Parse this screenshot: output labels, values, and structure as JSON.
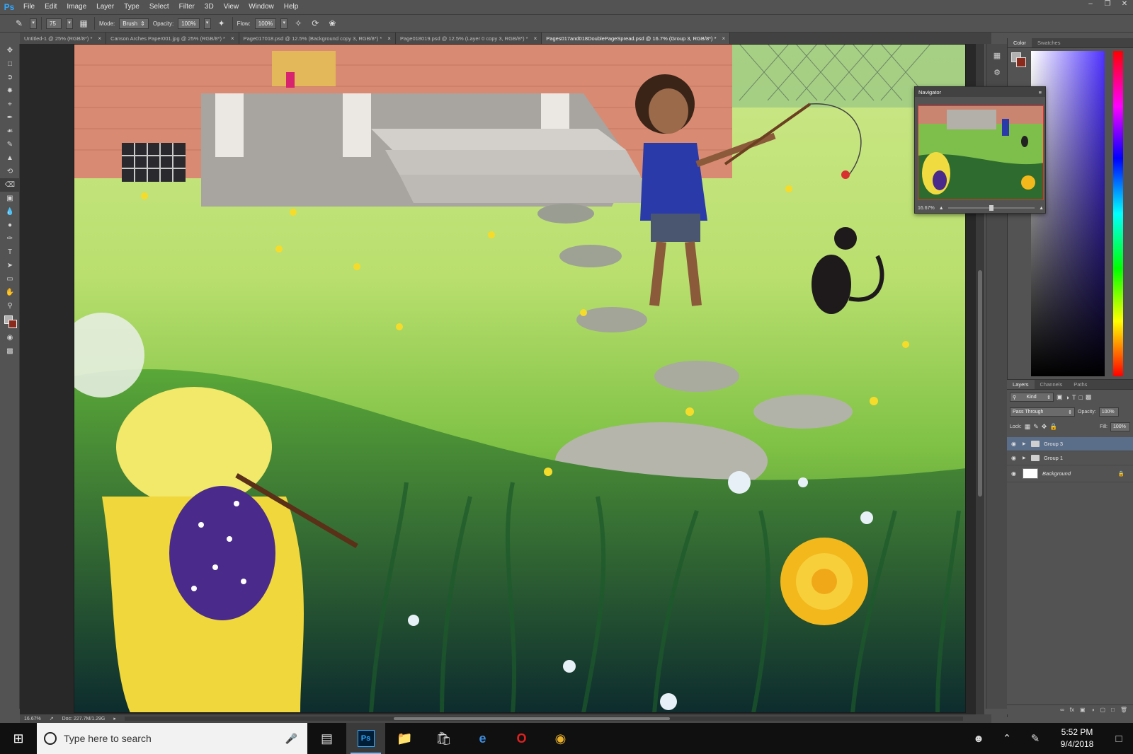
{
  "app": {
    "logo": "Ps",
    "menu": [
      "File",
      "Edit",
      "Image",
      "Layer",
      "Type",
      "Select",
      "Filter",
      "3D",
      "View",
      "Window",
      "Help"
    ],
    "window_controls": [
      "–",
      "❐",
      "✕"
    ]
  },
  "options_bar": {
    "brush_size": "75",
    "mode_label": "Mode:",
    "mode_value": "Brush",
    "opacity_label": "Opacity:",
    "opacity_value": "100%",
    "flow_label": "Flow:",
    "flow_value": "100%"
  },
  "tabs": [
    {
      "label": "Untitled-1 @ 25% (RGB/8*) *",
      "active": false
    },
    {
      "label": "Canson Arches Paper001.jpg @ 25% (RGB/8*) *",
      "active": false
    },
    {
      "label": "Page017018.psd @ 12.5% (Background copy 3, RGB/8*) *",
      "active": false
    },
    {
      "label": "Page018019.psd @ 12.5% (Layer 0 copy 3, RGB/8*) *",
      "active": false
    },
    {
      "label": "Pages017and018DoublePageSpread.psd @ 16.7% (Group 3, RGB/8*) *",
      "active": true
    }
  ],
  "status_bar": {
    "zoom": "16.67%",
    "doc": "Doc: 227.7M/1.29G"
  },
  "color_panel": {
    "tabs": [
      "Color",
      "Swatches"
    ],
    "fg_color": "#b1b1b1",
    "bg_color": "#8a2a1c"
  },
  "navigator": {
    "title": "Navigator",
    "zoom": "16.67%"
  },
  "layers_panel": {
    "tabs": [
      "Layers",
      "Channels",
      "Paths"
    ],
    "filter": "Kind",
    "blend_mode": "Pass Through",
    "opacity_label": "Opacity:",
    "opacity_value": "100%",
    "lock_label": "Lock:",
    "fill_label": "Fill:",
    "fill_value": "100%",
    "layers": [
      {
        "name": "Group 3",
        "type": "group",
        "selected": true
      },
      {
        "name": "Group 1",
        "type": "group",
        "selected": false
      },
      {
        "name": "Background",
        "type": "background",
        "selected": false
      }
    ]
  },
  "taskbar": {
    "search_placeholder": "Type here to search",
    "time": "5:52 PM",
    "date": "9/4/2018"
  }
}
